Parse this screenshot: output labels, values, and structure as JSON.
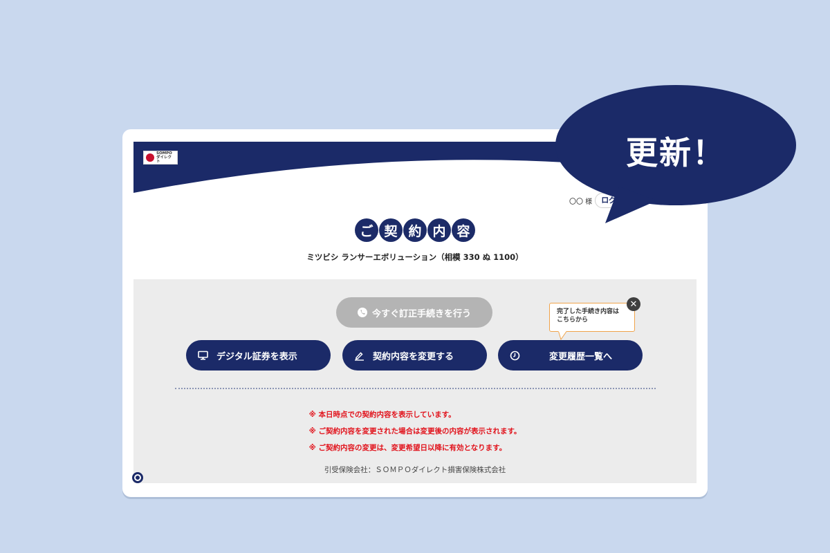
{
  "header": {
    "logo_line1": "SOMPO",
    "logo_line2": "ダイレクト",
    "user_name": "〇〇 様",
    "logout_label": "ログアウト"
  },
  "title": {
    "chars": [
      "ご",
      "契",
      "約",
      "内",
      "容"
    ]
  },
  "vehicle": "ミツビシ ランサーエボリューション（相模 330 ぬ 1100）",
  "buttons": {
    "correction": "今すぐ訂正手続きを行う",
    "digital": "デジタル証券を表示",
    "change": "契約内容を変更する",
    "history": "変更履歴一覧へ"
  },
  "tooltip": {
    "line1": "完了した手続き内容は",
    "line2": "こちらから",
    "close": "✕"
  },
  "notes": [
    "※ 本日時点での契約内容を表示しています。",
    "※ ご契約内容を変更された場合は変更後の内容が表示されます。",
    "※ ご契約内容の変更は、変更希望日以降に有効となります。"
  ],
  "insurer": "引受保険会社：ＳＯＭＰＯダイレクト損害保険株式会社",
  "speech_bubble": "更新！",
  "colors": {
    "navy": "#1b2a68",
    "background": "#c9d8ee",
    "panel": "#ececec",
    "note_red": "#e1131c",
    "tooltip_border": "#f0a34a"
  }
}
